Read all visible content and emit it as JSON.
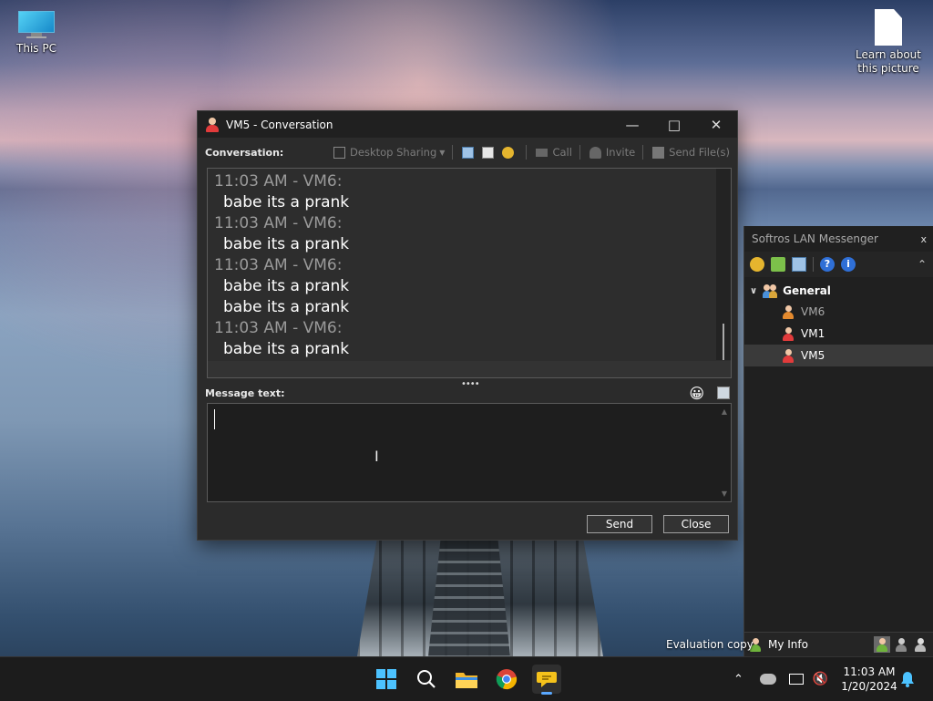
{
  "desktop": {
    "icons": [
      {
        "label": "This PC"
      },
      {
        "label": "Learn about this picture"
      }
    ],
    "eval_text": "Evaluation copy"
  },
  "conversation_window": {
    "title": "VM5 - Conversation",
    "conversation_label": "Conversation:",
    "toolbar": {
      "desktop_sharing": "Desktop Sharing",
      "call": "Call",
      "invite": "Invite",
      "send_files": "Send File(s)"
    },
    "messages": [
      {
        "header": "11:03 AM - VM6:",
        "lines": [
          "babe its a prank"
        ]
      },
      {
        "header": "11:03 AM - VM6:",
        "lines": [
          "babe its a prank"
        ]
      },
      {
        "header": "11:03 AM - VM6:",
        "lines": [
          "babe its a prank",
          "babe its a prank"
        ]
      },
      {
        "header": "11:03 AM - VM6:",
        "lines": [
          "babe its a prank"
        ]
      }
    ],
    "message_text_label": "Message text:",
    "message_input_value": "",
    "send_label": "Send",
    "close_label": "Close"
  },
  "messenger_panel": {
    "title": "Softros LAN Messenger",
    "close_glyph": "x",
    "group": "General",
    "users": [
      {
        "name": "VM6",
        "status": "away",
        "color": "#a9a9a9"
      },
      {
        "name": "VM1",
        "status": "online",
        "color": "#ffffff"
      },
      {
        "name": "VM5",
        "status": "online",
        "color": "#ffffff"
      }
    ],
    "my_info": "My Info"
  },
  "taskbar": {
    "apps": [
      "start",
      "search",
      "file-explorer",
      "chrome",
      "softros-messenger"
    ],
    "time": "11:03 AM",
    "date": "1/20/2024"
  }
}
